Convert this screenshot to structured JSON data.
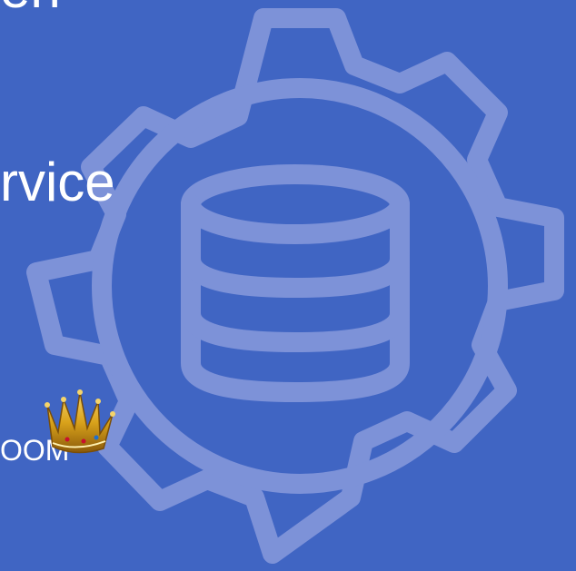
{
  "slide": {
    "text_top": "en",
    "text_service": "rvice",
    "text_zoom": "OOM"
  },
  "icons": {
    "background_icon": "gear-database-icon",
    "crown_icon": "crown-icon"
  },
  "colors": {
    "background": "#4065c3",
    "icon_outline": "#7d92d8",
    "text": "#ffffff",
    "crown_gold": "#d9a21b"
  }
}
